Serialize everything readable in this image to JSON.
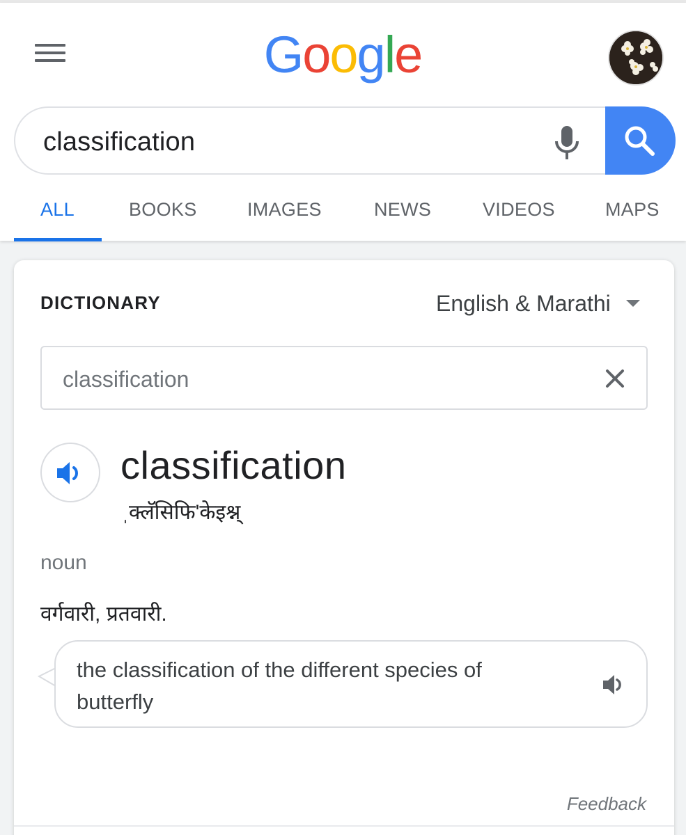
{
  "header": {
    "logo": {
      "letters": [
        "G",
        "o",
        "o",
        "g",
        "l",
        "e"
      ],
      "colors": [
        "#4285f4",
        "#ea4335",
        "#fbbc05",
        "#4285f4",
        "#34a853",
        "#ea4335"
      ]
    },
    "menu_icon": "hamburger-menu-icon",
    "avatar_icon": "profile-avatar"
  },
  "search": {
    "query": "classification",
    "mic_icon": "microphone-icon",
    "search_icon": "search-icon",
    "button_color": "#4285f4"
  },
  "tabs": [
    {
      "label": "ALL",
      "active": true
    },
    {
      "label": "BOOKS",
      "active": false
    },
    {
      "label": "IMAGES",
      "active": false
    },
    {
      "label": "NEWS",
      "active": false
    },
    {
      "label": "VIDEOS",
      "active": false
    },
    {
      "label": "MAPS",
      "active": false
    }
  ],
  "accent_color": "#1a73e8",
  "dictionary": {
    "label": "DICTIONARY",
    "language": "English & Marathi",
    "input_value": "classification",
    "headword": "classification",
    "phonetic": "ˌक्लॅसिफि'केइश्न्",
    "part_of_speech": "noun",
    "definition": "वर्गवारी, प्रतवारी.",
    "example": "the classification of the different species of butterfly",
    "feedback": "Feedback"
  }
}
